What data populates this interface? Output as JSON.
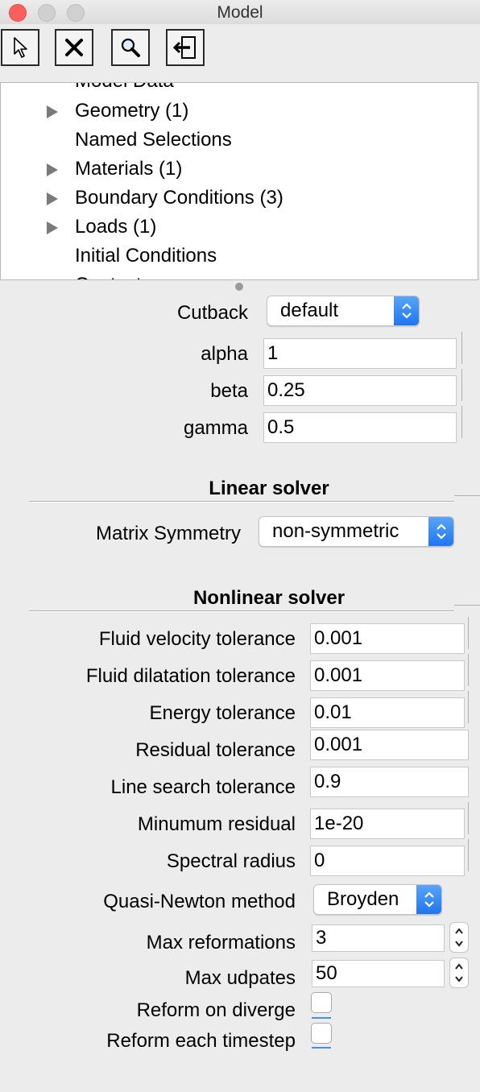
{
  "window": {
    "title": "Model"
  },
  "toolbar": [
    {
      "name": "select-tool-button",
      "icon": "pointer-arrow-icon"
    },
    {
      "name": "delete-button",
      "icon": "x-icon"
    },
    {
      "name": "search-button",
      "icon": "magnifier-icon"
    },
    {
      "name": "exit-button",
      "icon": "exit-door-icon"
    }
  ],
  "tree": {
    "items": [
      {
        "label": "Model Data",
        "expandable": false
      },
      {
        "label": "Geometry (1)",
        "expandable": true
      },
      {
        "label": "Named Selections",
        "expandable": false
      },
      {
        "label": "Materials (1)",
        "expandable": true
      },
      {
        "label": "Boundary Conditions (3)",
        "expandable": true
      },
      {
        "label": "Loads (1)",
        "expandable": true
      },
      {
        "label": "Initial Conditions",
        "expandable": false
      },
      {
        "label": "Contact",
        "expandable": false
      }
    ]
  },
  "cutback": {
    "label": "Cutback",
    "value": "default"
  },
  "alpha": {
    "label": "alpha",
    "value": "1"
  },
  "beta": {
    "label": "beta",
    "value": "0.25"
  },
  "gamma": {
    "label": "gamma",
    "value": "0.5"
  },
  "linear_solver": {
    "title": "Linear solver",
    "matrix_symmetry": {
      "label": "Matrix Symmetry",
      "value": "non-symmetric"
    }
  },
  "nonlinear_solver": {
    "title": "Nonlinear solver",
    "fluid_velocity_tol": {
      "label": "Fluid velocity tolerance",
      "value": "0.001"
    },
    "fluid_dilatation_tol": {
      "label": "Fluid dilatation tolerance",
      "value": "0.001"
    },
    "energy_tol": {
      "label": "Energy tolerance",
      "value": "0.01"
    },
    "residual_tol": {
      "label": "Residual tolerance",
      "value": "0.001"
    },
    "line_search_tol": {
      "label": "Line search tolerance",
      "value": "0.9"
    },
    "min_residual": {
      "label": "Minumum residual",
      "value": "1e-20"
    },
    "spectral_radius": {
      "label": "Spectral radius",
      "value": "0"
    },
    "quasi_newton": {
      "label": "Quasi-Newton method",
      "value": "Broyden"
    },
    "max_reformations": {
      "label": "Max reformations",
      "value": "3"
    },
    "max_updates": {
      "label": "Max udpates",
      "value": "50"
    },
    "reform_on_diverge": {
      "label": "Reform on diverge",
      "checked": false
    },
    "reform_each_timestep": {
      "label": "Reform each timestep",
      "checked": false
    }
  },
  "colors": {
    "accent": "#1d74ef",
    "close": "#fc605c"
  }
}
